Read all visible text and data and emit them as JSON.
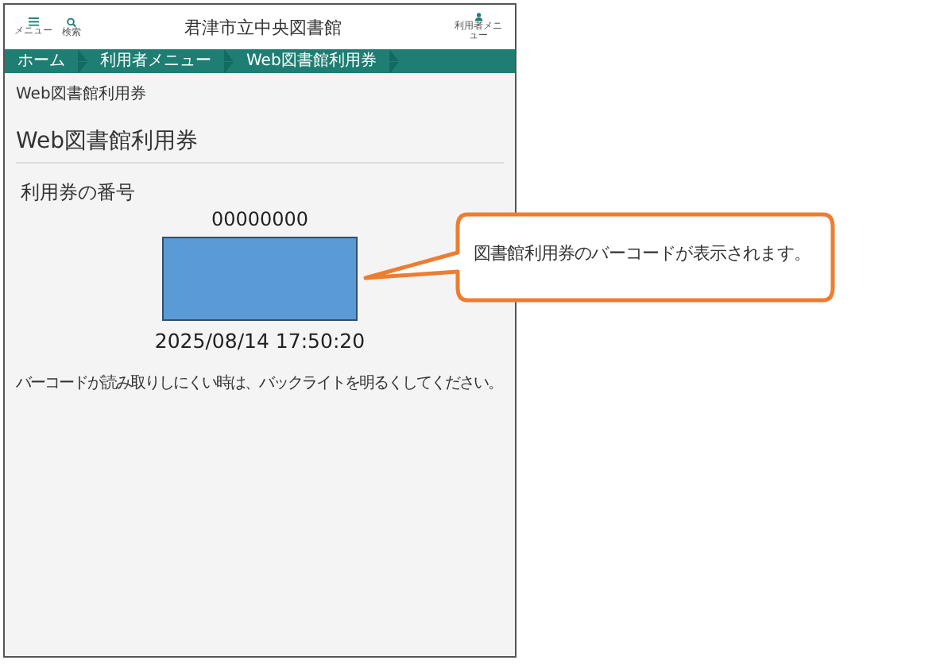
{
  "header": {
    "menu": {
      "label": "メニュー"
    },
    "search": {
      "label": "検索"
    },
    "title": "君津市立中央図書館",
    "user_menu": {
      "label": "利用者メニュー"
    }
  },
  "breadcrumb": [
    {
      "label": "ホーム"
    },
    {
      "label": "利用者メニュー"
    },
    {
      "label": "Web図書館利用券"
    }
  ],
  "page_label": "Web図書館利用券",
  "heading": "Web図書館利用券",
  "section_title": "利用券の番号",
  "card_number": "00000000",
  "timestamp": "2025/08/14 17:50:20",
  "note": "バーコードが読み取りしにくい時は、バックライトを明るくしてください。",
  "callout": {
    "text": "図書館利用券のバーコードが表示されます。"
  }
}
